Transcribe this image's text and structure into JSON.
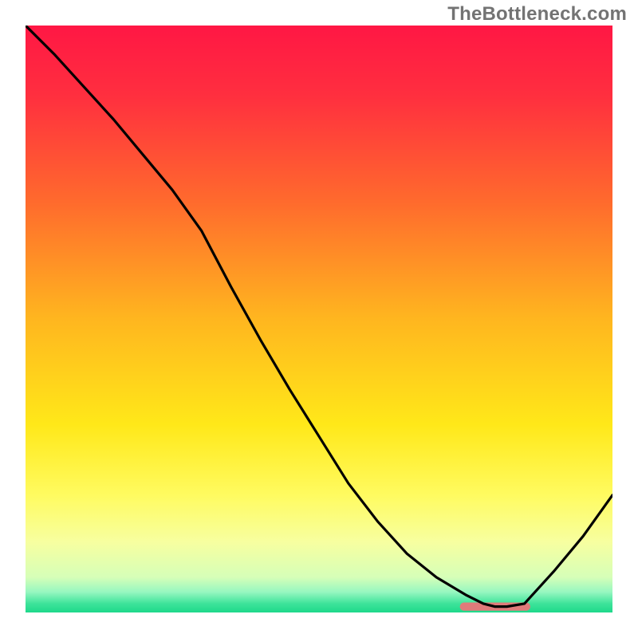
{
  "watermark": "TheBottleneck.com",
  "chart_data": {
    "type": "line",
    "title": "",
    "xlabel": "",
    "ylabel": "",
    "xlim": [
      0,
      100
    ],
    "ylim": [
      0,
      100
    ],
    "grid": false,
    "legend": false,
    "gradient_stops": [
      {
        "pct": 0.0,
        "color": "#ff1744"
      },
      {
        "pct": 0.12,
        "color": "#ff2f3f"
      },
      {
        "pct": 0.3,
        "color": "#ff6a2d"
      },
      {
        "pct": 0.5,
        "color": "#ffb61f"
      },
      {
        "pct": 0.68,
        "color": "#ffe819"
      },
      {
        "pct": 0.8,
        "color": "#fffb60"
      },
      {
        "pct": 0.88,
        "color": "#f7ffa0"
      },
      {
        "pct": 0.94,
        "color": "#d6ffb8"
      },
      {
        "pct": 0.965,
        "color": "#97f7c0"
      },
      {
        "pct": 0.985,
        "color": "#3de39a"
      },
      {
        "pct": 1.0,
        "color": "#1fd98b"
      }
    ],
    "series": [
      {
        "name": "curve",
        "color": "#000000",
        "x": [
          0,
          5,
          10,
          15,
          20,
          25,
          30,
          35,
          40,
          45,
          50,
          55,
          60,
          65,
          70,
          75,
          78,
          80,
          82,
          85,
          90,
          95,
          100
        ],
        "y": [
          100,
          95,
          89.5,
          84,
          78,
          72,
          65,
          55.5,
          46.5,
          38,
          30,
          22,
          15.5,
          10,
          6,
          3,
          1.5,
          1,
          1,
          1.5,
          7,
          13,
          20
        ]
      }
    ],
    "marker": {
      "name": "highlight-bar",
      "color": "#e07a7a",
      "x_start": 74,
      "x_end": 86,
      "y": 1,
      "thickness_pct": 1.4
    }
  }
}
